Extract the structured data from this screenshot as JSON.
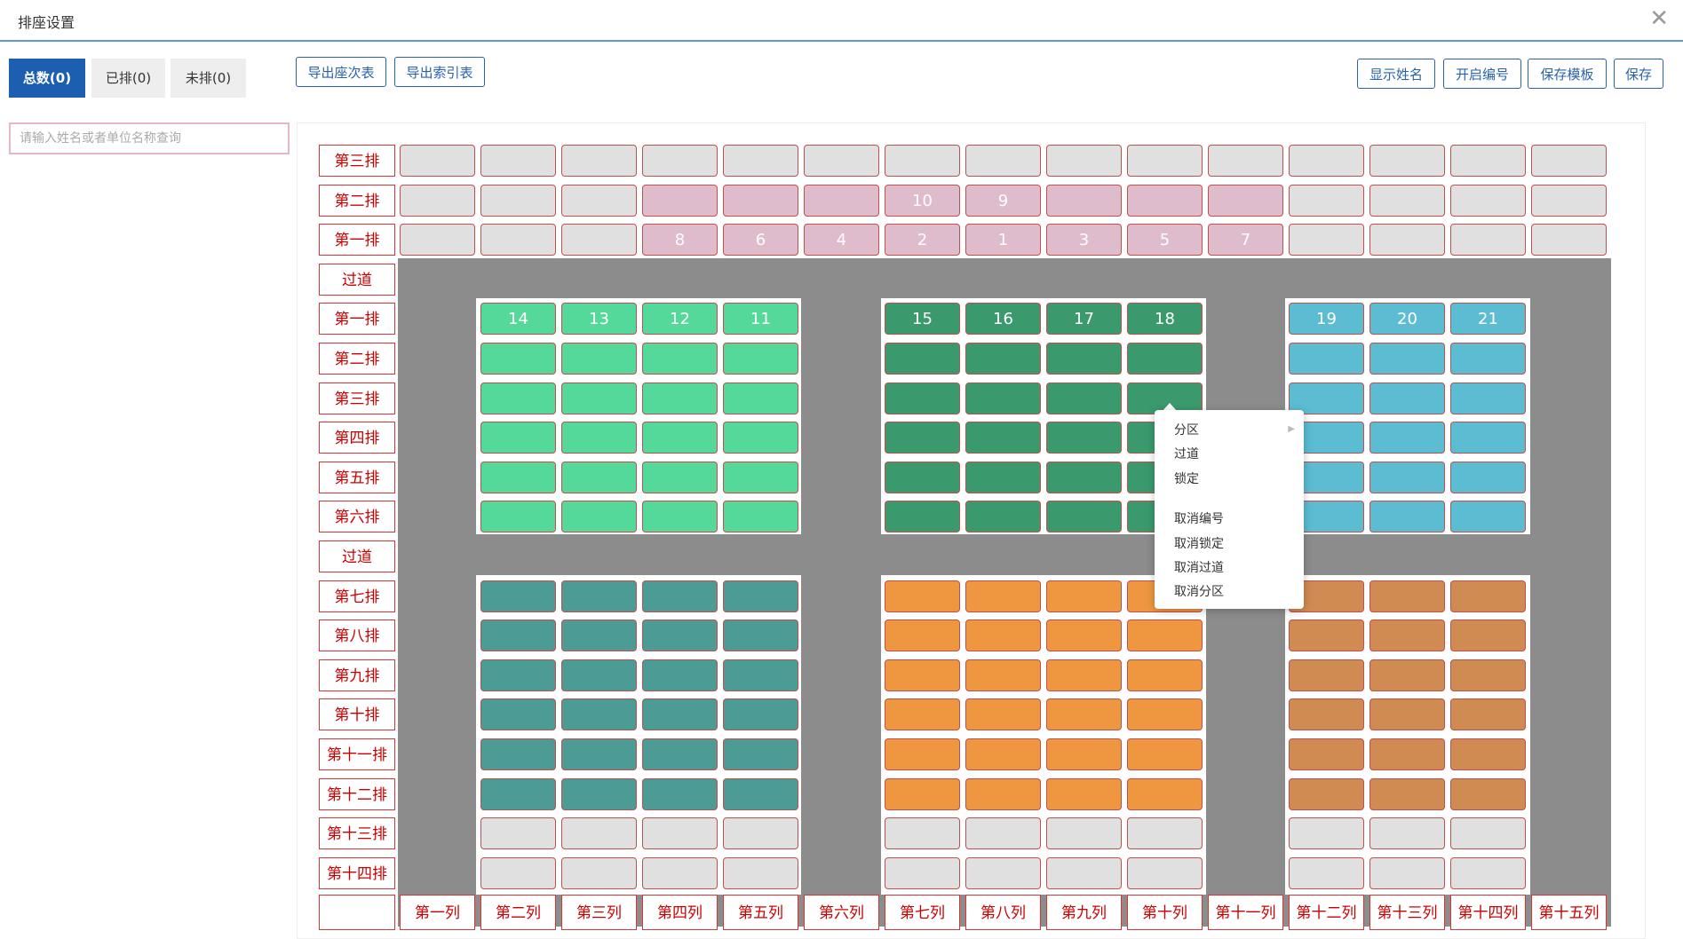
{
  "window": {
    "title": "排座设置",
    "close_icon": "close-icon"
  },
  "tabs": [
    {
      "label": "总数(0)",
      "active": true
    },
    {
      "label": "已排(0)",
      "active": false
    },
    {
      "label": "未排(0)",
      "active": false
    }
  ],
  "toolbar": {
    "export_seat_table": "导出座次表",
    "export_index_table": "导出索引表",
    "show_name": "显示姓名",
    "enable_numbering": "开启编号",
    "save_template": "保存模板",
    "save": "保存"
  },
  "search": {
    "placeholder": "请输入姓名或者单位名称查询",
    "value": ""
  },
  "colors": {
    "empty": "#e0e0e0",
    "pink": "#dfbccb",
    "lightgreen": "#55d99a",
    "darkgreen": "#3a9a6e",
    "blue": "#5bbcd2",
    "teal": "#4c9b95",
    "orange": "#ee9740",
    "tan": "#cf8b52",
    "aisle": "#8c8c8c"
  },
  "row_labels": [
    "第三排",
    "第二排",
    "第一排",
    "过道",
    "第一排",
    "第二排",
    "第三排",
    "第四排",
    "第五排",
    "第六排",
    "过道",
    "第七排",
    "第八排",
    "第九排",
    "第十排",
    "第十一排",
    "第十二排",
    "第十三排",
    "第十四排"
  ],
  "col_labels": [
    "",
    "第一列",
    "第二列",
    "第三列",
    "第四列",
    "第五列",
    "第六列",
    "第七列",
    "第八列",
    "第九列",
    "第十列",
    "第十一列",
    "第十二列",
    "第十三列",
    "第十四列",
    "第十五列"
  ],
  "front_rows": [
    {
      "colors": [
        "empty",
        "empty",
        "empty",
        "empty",
        "empty",
        "empty",
        "empty",
        "empty",
        "empty",
        "empty",
        "empty",
        "empty",
        "empty",
        "empty",
        "empty"
      ],
      "numbers": [
        "",
        "",
        "",
        "",
        "",
        "",
        "",
        "",
        "",
        "",
        "",
        "",
        "",
        "",
        ""
      ]
    },
    {
      "colors": [
        "empty",
        "empty",
        "empty",
        "pink",
        "pink",
        "pink",
        "pink",
        "pink",
        "pink",
        "pink",
        "pink",
        "empty",
        "empty",
        "empty",
        "empty"
      ],
      "numbers": [
        "",
        "",
        "",
        "",
        "",
        "",
        "10",
        "9",
        "",
        "",
        "",
        "",
        "",
        "",
        ""
      ]
    },
    {
      "colors": [
        "empty",
        "empty",
        "empty",
        "pink",
        "pink",
        "pink",
        "pink",
        "pink",
        "pink",
        "pink",
        "pink",
        "empty",
        "empty",
        "empty",
        "empty"
      ],
      "numbers": [
        "",
        "",
        "",
        "8",
        "6",
        "4",
        "2",
        "1",
        "3",
        "5",
        "7",
        "",
        "",
        "",
        ""
      ]
    }
  ],
  "blocks": [
    {
      "color": "lightgreen",
      "cols": [
        2,
        3,
        4,
        5
      ],
      "row_start": 4,
      "row_count": 6,
      "first_row_numbers": [
        "14",
        "13",
        "12",
        "11"
      ]
    },
    {
      "color": "darkgreen",
      "cols": [
        7,
        8,
        9,
        10
      ],
      "row_start": 4,
      "row_count": 6,
      "first_row_numbers": [
        "15",
        "16",
        "17",
        "18"
      ]
    },
    {
      "color": "blue",
      "cols": [
        12,
        13,
        14
      ],
      "row_start": 4,
      "row_count": 6,
      "first_row_numbers": [
        "19",
        "20",
        "21"
      ]
    },
    {
      "color": "teal",
      "cols": [
        2,
        3,
        4,
        5
      ],
      "row_start": 11,
      "row_count": 6,
      "first_row_numbers": [
        "",
        "",
        "",
        ""
      ]
    },
    {
      "color": "orange",
      "cols": [
        7,
        8,
        9,
        10
      ],
      "row_start": 11,
      "row_count": 6,
      "first_row_numbers": [
        "",
        "",
        "",
        ""
      ]
    },
    {
      "color": "tan",
      "cols": [
        12,
        13,
        14
      ],
      "row_start": 11,
      "row_count": 6,
      "first_row_numbers": [
        "",
        "",
        ""
      ]
    },
    {
      "color": "empty",
      "cols": [
        2,
        3,
        4,
        5
      ],
      "row_start": 17,
      "row_count": 2,
      "first_row_numbers": [
        "",
        "",
        "",
        ""
      ]
    },
    {
      "color": "empty",
      "cols": [
        7,
        8,
        9,
        10
      ],
      "row_start": 17,
      "row_count": 2,
      "first_row_numbers": [
        "",
        "",
        "",
        ""
      ]
    },
    {
      "color": "empty",
      "cols": [
        12,
        13,
        14
      ],
      "row_start": 17,
      "row_count": 2,
      "first_row_numbers": [
        "",
        "",
        ""
      ]
    }
  ],
  "context_menu": {
    "items": [
      "分区",
      "过道",
      "锁定",
      "",
      "取消编号",
      "取消锁定",
      "取消过道",
      "取消分区"
    ],
    "submenu_icon": "caret-right-icon"
  }
}
